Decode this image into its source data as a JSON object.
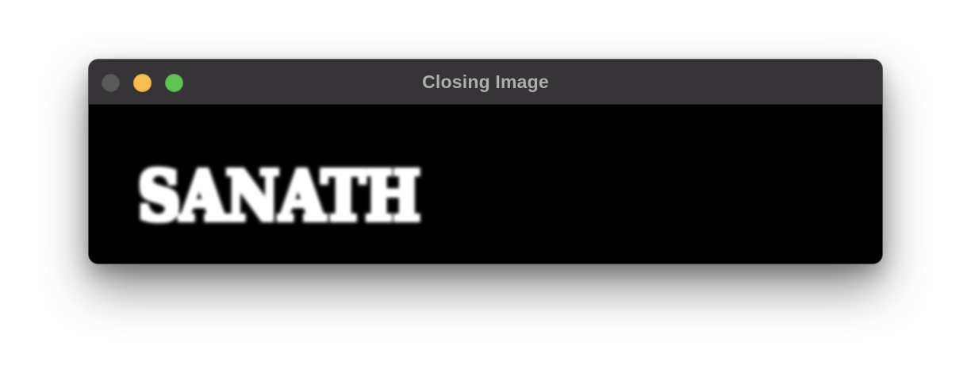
{
  "window": {
    "title": "Closing Image",
    "controls": {
      "close": "close-button",
      "minimize": "minimize-button",
      "maximize": "maximize-button"
    },
    "colors": {
      "titlebar": "#363436",
      "title_text": "#aeadae",
      "close": "#5a595a",
      "minimize": "#f6bd4f",
      "maximize": "#5fc454",
      "content_bg": "#000000"
    }
  },
  "image": {
    "text": "SANATH",
    "foreground": "#ffffff",
    "background": "#000000"
  }
}
